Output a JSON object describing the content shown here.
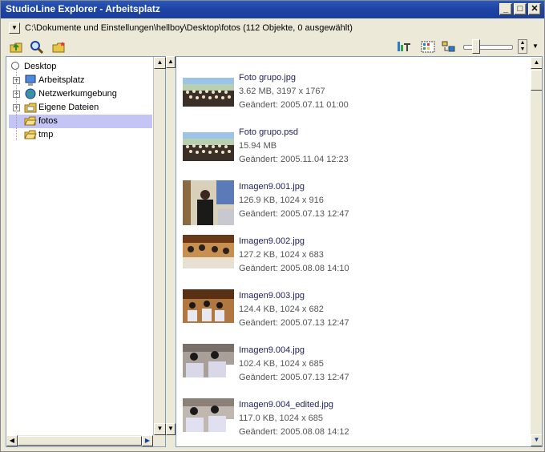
{
  "window": {
    "title": "StudioLine Explorer - Arbeitsplatz",
    "minimize_label": "_",
    "maximize_label": "□",
    "close_label": "✕"
  },
  "address": {
    "path_text": "C:\\Dokumente und Einstellungen\\hellboy\\Desktop\\fotos  (112 Objekte, 0 ausgewählt)"
  },
  "toolbar": {
    "icons": [
      "up-folder-icon",
      "search-icon",
      "new-folder-icon",
      "sort-icon",
      "view-grid-icon",
      "arrange-icon"
    ]
  },
  "tree": {
    "items": [
      {
        "label": "Desktop"
      },
      {
        "label": "Arbeitsplatz"
      },
      {
        "label": "Netzwerkumgebung"
      },
      {
        "label": "Eigene Dateien"
      },
      {
        "label": "fotos"
      },
      {
        "label": "tmp"
      }
    ]
  },
  "files": [
    {
      "name": "Foto grupo.jpg",
      "size": "3.62 MB, 3197 x 1767",
      "changed": "Geändert: 2005.07.11 01:00"
    },
    {
      "name": "Foto grupo.psd",
      "size": "15.94 MB",
      "changed": "Geändert: 2005.11.04 12:23"
    },
    {
      "name": "Imagen9.001.jpg",
      "size": "126.9 KB, 1024 x 916",
      "changed": "Geändert: 2005.07.13 12:47"
    },
    {
      "name": "Imagen9.002.jpg",
      "size": "127.2 KB, 1024 x 683",
      "changed": "Geändert: 2005.08.08 14:10"
    },
    {
      "name": "Imagen9.003.jpg",
      "size": "124.4 KB, 1024 x 682",
      "changed": "Geändert: 2005.07.13 12:47"
    },
    {
      "name": "Imagen9.004.jpg",
      "size": "102.4 KB, 1024 x 685",
      "changed": "Geändert: 2005.07.13 12:47"
    },
    {
      "name": "Imagen9.004_edited.jpg",
      "size": "117.0 KB, 1024 x 685",
      "changed": "Geändert: 2005.08.08 14:12"
    }
  ],
  "colors": {
    "titlebar": "#1d44a6",
    "selection": "#c5c5f5",
    "filename": "#1f1f60"
  }
}
